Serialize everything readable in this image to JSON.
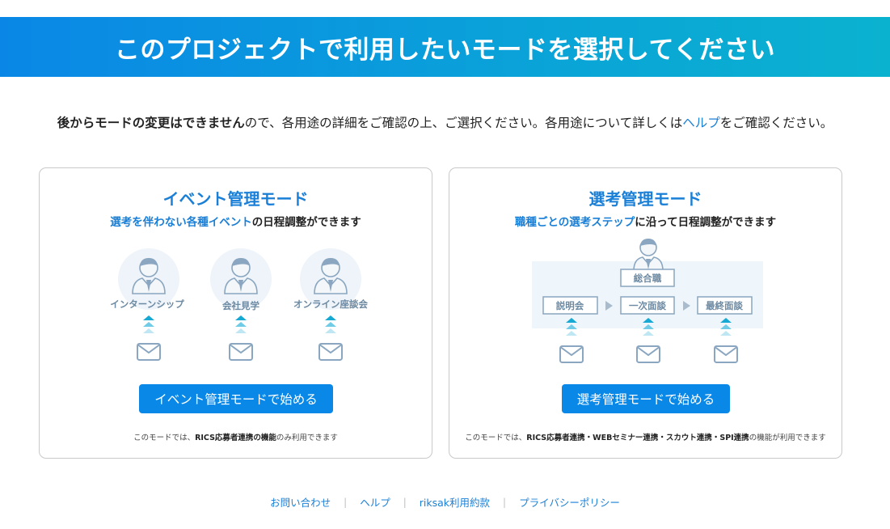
{
  "header": {
    "title": "このプロジェクトで利用したいモードを選択してください"
  },
  "notice": {
    "bold": "後からモードの変更はできません",
    "text1": "ので、各用途の詳細をご確認の上、ご選択ください。各用途について詳しくは",
    "help_link": "ヘルプ",
    "text2": "をご確認ください。"
  },
  "event_card": {
    "title": "イベント管理モード",
    "sub_highlight": "選考を伴わない各種イベント",
    "sub_rest": "の日程調整ができます",
    "items": [
      "インターンシップ",
      "会社見学",
      "オンライン座談会"
    ],
    "button": "イベント管理モードで始める",
    "note_prefix": "このモードでは、",
    "note_bold": "RICS応募者連携の機能",
    "note_suffix": "のみ利用できます"
  },
  "selection_card": {
    "title": "選考管理モード",
    "sub_highlight": "職種ごとの選考ステップ",
    "sub_rest": "に沿って日程調整ができます",
    "job_label": "総合職",
    "steps": [
      "説明会",
      "一次面談",
      "最終面談"
    ],
    "button": "選考管理モードで始める",
    "note_prefix": "このモードでは、",
    "note_bold": "RICS応募者連携・WEBセミナー連携・スカウト連携・SPI連携",
    "note_suffix": "の機能が利用できます"
  },
  "footer": {
    "links": [
      "お問い合わせ",
      "ヘルプ",
      "riksak利用約款",
      "プライバシーポリシー"
    ]
  },
  "colors": {
    "accent": "#1a7fd6",
    "button": "#0a88e8",
    "banner_start": "#0a87e6",
    "banner_end": "#0bb2cf",
    "illustration_gray": "#8aa6c0"
  }
}
